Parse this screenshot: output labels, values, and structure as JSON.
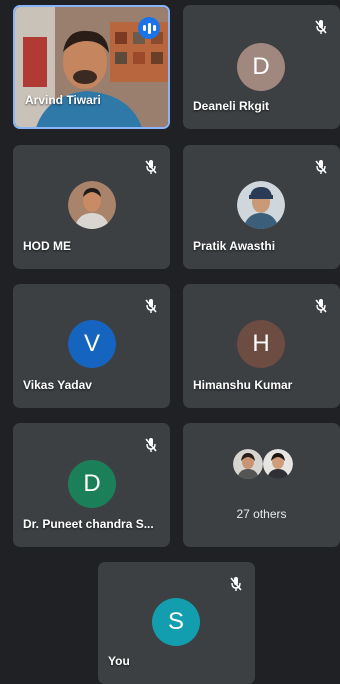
{
  "participants": [
    {
      "name": "Arvind Tiwari",
      "speaking": true,
      "mic": "active"
    },
    {
      "name": "Deaneli Rkgit",
      "initial": "D",
      "avatar_color": "#a1887f"
    },
    {
      "name": "HOD ME"
    },
    {
      "name": "Pratik Awasthi"
    },
    {
      "name": "Vikas Yadav",
      "initial": "V",
      "avatar_color": "#1565c0"
    },
    {
      "name": "Himanshu Kumar",
      "initial": "H",
      "avatar_color": "#6d4c41"
    },
    {
      "name": "Dr. Puneet chandra S...",
      "initial": "D",
      "avatar_color": "#1b7f5a"
    },
    {
      "name": "You",
      "initial": "S",
      "avatar_color": "#129eaf"
    }
  ],
  "others": {
    "label": "27 others"
  },
  "icons": {
    "mic_off": "mic-off-icon",
    "speaking": "audio-level-icon"
  },
  "colors": {
    "background": "#202124",
    "tile": "#3c4043",
    "speaking_border": "#8ab4f8"
  }
}
